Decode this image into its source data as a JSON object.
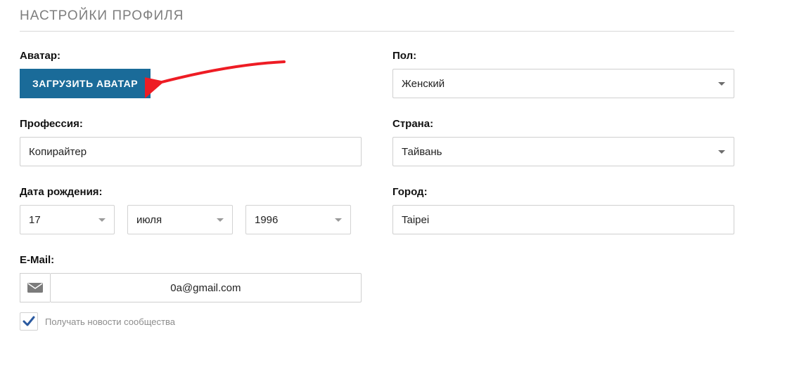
{
  "section_title": "НАСТРОЙКИ ПРОФИЛЯ",
  "left": {
    "avatar_label": "Аватар:",
    "upload_button": "ЗАГРУЗИТЬ АВАТАР",
    "profession_label": "Профессия:",
    "profession_value": "Копирайтер",
    "dob_label": "Дата рождения:",
    "dob_day": "17",
    "dob_month": "июля",
    "dob_year": "1996",
    "email_label": "E-Mail:",
    "email_value": "0a@gmail.com",
    "newsletter_checked": true,
    "newsletter_label": "Получать новости сообщества"
  },
  "right": {
    "gender_label": "Пол:",
    "gender_value": "Женский",
    "country_label": "Страна:",
    "country_value": "Тайвань",
    "city_label": "Город:",
    "city_value": "Taipei"
  },
  "colors": {
    "accent": "#1a6b99",
    "check": "#2b5aa0",
    "arrow": "#ee1c24"
  }
}
